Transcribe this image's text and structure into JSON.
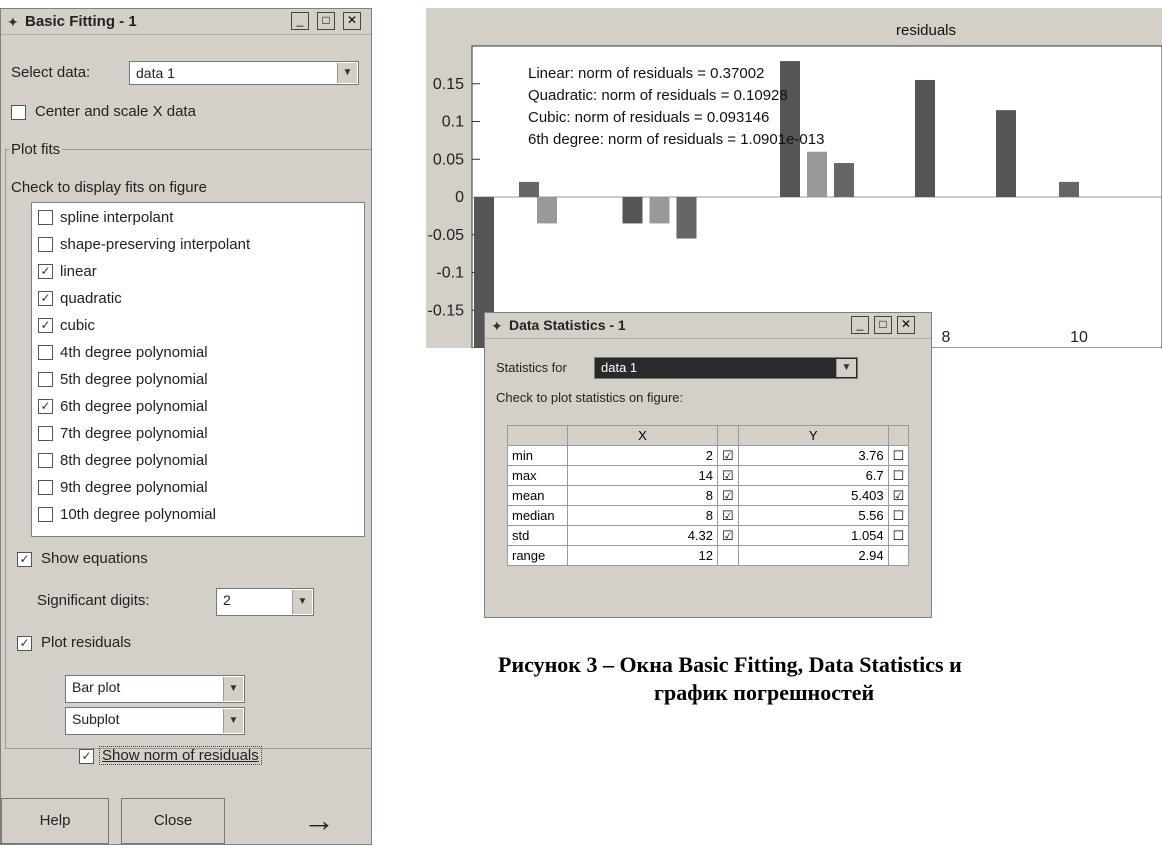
{
  "basic_fitting": {
    "title": "Basic Fitting - 1",
    "select_data_label": "Select data:",
    "select_data_value": "data 1",
    "center_scale_label": "Center and scale X data",
    "plot_fits_legend": "Plot fits",
    "check_display_label": "Check to display fits on figure",
    "fits": [
      {
        "label": "spline interpolant",
        "checked": false
      },
      {
        "label": "shape-preserving interpolant",
        "checked": false
      },
      {
        "label": "linear",
        "checked": true
      },
      {
        "label": "quadratic",
        "checked": true
      },
      {
        "label": "cubic",
        "checked": true
      },
      {
        "label": "4th degree polynomial",
        "checked": false
      },
      {
        "label": "5th degree polynomial",
        "checked": false
      },
      {
        "label": "6th degree polynomial",
        "checked": true
      },
      {
        "label": "7th degree polynomial",
        "checked": false
      },
      {
        "label": "8th degree polynomial",
        "checked": false
      },
      {
        "label": "9th degree polynomial",
        "checked": false
      },
      {
        "label": "10th degree polynomial",
        "checked": false
      }
    ],
    "show_equations_label": "Show equations",
    "significant_digits_label": "Significant digits:",
    "significant_digits_value": "2",
    "plot_residuals_label": "Plot residuals",
    "residual_plot_type": "Bar plot",
    "residual_plot_location": "Subplot",
    "show_norm_label": "Show norm of residuals",
    "help_label": "Help",
    "close_label": "Close",
    "arrow_glyph": "→"
  },
  "chart_data": {
    "type": "bar",
    "title": "residuals",
    "ylim": [
      -0.2,
      0.2
    ],
    "yticks": [
      "0.15",
      "0.1",
      "0.05",
      "0",
      "-0.05",
      "-0.1",
      "-0.15"
    ],
    "ytick_values": [
      0.15,
      0.1,
      0.05,
      0,
      -0.05,
      -0.1,
      -0.15
    ],
    "xticks_visible": [
      "8",
      "10"
    ],
    "annotations": [
      "Linear: norm of residuals = 0.37002",
      "Quadratic: norm of residuals = 0.10928",
      "Cubic: norm of residuals = 0.093146",
      "6th degree: norm of residuals = 1.0901e-013"
    ],
    "series": [
      {
        "color": "#555555",
        "values": [
          -0.21,
          -0.035,
          0.18,
          0.155,
          0.115
        ]
      },
      {
        "color": "#666666",
        "values": [
          0.02,
          -0.055,
          0.045,
          0.02
        ]
      },
      {
        "color": "#999999",
        "values": [
          -0.035,
          0.06
        ]
      }
    ],
    "positions_x": [
      2,
      3,
      4,
      5,
      6,
      7,
      8,
      9,
      10,
      11,
      12,
      13,
      14
    ]
  },
  "data_statistics": {
    "title": "Data Statistics - 1",
    "statistics_for_label": "Statistics for",
    "statistics_for_value": "data 1",
    "check_plot_label": "Check to plot statistics on figure:",
    "col_x": "X",
    "col_y": "Y",
    "rows": [
      {
        "name": "min",
        "x": "2",
        "x_checked": true,
        "y": "3.76",
        "y_checked": false
      },
      {
        "name": "max",
        "x": "14",
        "x_checked": true,
        "y": "6.7",
        "y_checked": false
      },
      {
        "name": "mean",
        "x": "8",
        "x_checked": true,
        "y": "5.403",
        "y_checked": true
      },
      {
        "name": "median",
        "x": "8",
        "x_checked": true,
        "y": "5.56",
        "y_checked": false
      },
      {
        "name": "std",
        "x": "4.32",
        "x_checked": true,
        "y": "1.054",
        "y_checked": false
      },
      {
        "name": "range",
        "x": "12",
        "x_checked": null,
        "y": "2.94",
        "y_checked": null
      }
    ]
  },
  "caption": {
    "line1": "Рисунок 3 – Окна Basic Fitting, Data Statistics и",
    "line2": "график погрешностей"
  }
}
